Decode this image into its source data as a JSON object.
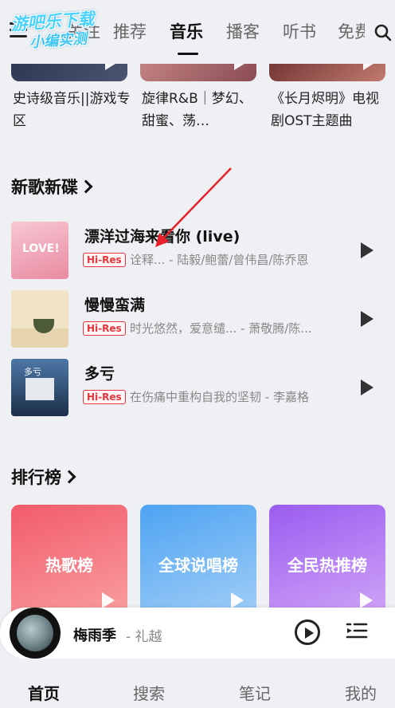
{
  "watermark": {
    "line1": "游吧乐下载",
    "line2": "小编实测"
  },
  "top_tabs": [
    {
      "label": "关注"
    },
    {
      "label": "推荐"
    },
    {
      "label": "音乐"
    },
    {
      "label": "播客"
    },
    {
      "label": "听书"
    },
    {
      "label": "免费"
    }
  ],
  "playlists": [
    {
      "title": "史诗级音乐||游戏专区"
    },
    {
      "title": "旋律R&B｜梦幻、甜蜜、荡…"
    },
    {
      "title": "《长月烬明》电视剧OST主题曲"
    }
  ],
  "new_songs": {
    "title": "新歌新碟",
    "items": [
      {
        "name": "漂洋过海来看你 (live)",
        "badge": "Hi-Res",
        "sub": "诠释... - 陆毅/鲍蕾/曾伟昌/陈乔恩",
        "cover_text": "LOVE!"
      },
      {
        "name": "慢慢蛮满",
        "badge": "Hi-Res",
        "sub": "时光悠然，爱意缱... - 萧敬腾/陈...",
        "cover_text": ""
      },
      {
        "name": "多亏",
        "badge": "Hi-Res",
        "sub": "在伤痛中重构自我的坚韧 - 李嘉格",
        "cover_text": "多亏"
      }
    ]
  },
  "charts": {
    "title": "排行榜",
    "items": [
      {
        "label": "热歌榜",
        "color_top": "#f25b6b",
        "color_bottom": "#f9a2a2"
      },
      {
        "label": "全球说唱榜",
        "color_top": "#4da3f2",
        "color_bottom": "#a6d0f7"
      },
      {
        "label": "全民热推榜",
        "color_top": "#9a5cf0",
        "color_bottom": "#d3a8f7"
      }
    ]
  },
  "now_playing": {
    "title": "梅雨季",
    "artist": "- 礼越"
  },
  "bottom_nav": [
    {
      "label": "首页"
    },
    {
      "label": "搜索"
    },
    {
      "label": "笔记"
    },
    {
      "label": "我的"
    }
  ],
  "colors": {
    "accent_hires": "#e8333c",
    "background": "#eef0f3",
    "annotation_arrow": "#e8202a"
  }
}
